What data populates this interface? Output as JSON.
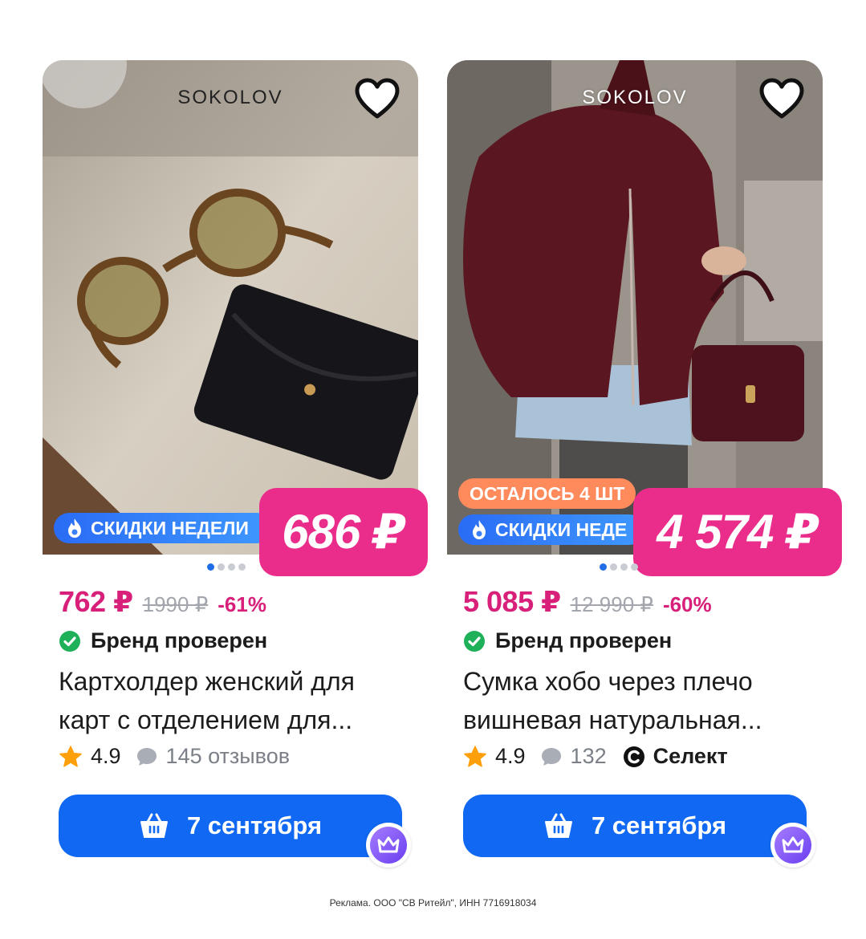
{
  "products": [
    {
      "brand": "SOKOLOV",
      "badges": {
        "sale": "СКИДКИ НЕДЕЛИ"
      },
      "big_price": "686 ₽",
      "price_now": "762 ₽",
      "price_old": "1990 ₽",
      "discount": "-61%",
      "verified": "Бренд проверен",
      "title_line1": "Картхолдер женский для",
      "title_line2": "карт с отделением для...",
      "rating": "4.9",
      "reviews": "145 отзывов",
      "delivery": "7 сентября"
    },
    {
      "brand": "SOKOLOV",
      "badges": {
        "left": "ОСТАЛОСЬ 4 ШТ",
        "sale": "СКИДКИ НЕДЕ"
      },
      "big_price": "4 574 ₽",
      "price_now": "5 085 ₽",
      "price_old": "12 990 ₽",
      "discount": "-60%",
      "verified": "Бренд проверен",
      "title_line1": "Сумка хобо через плечо",
      "title_line2": "вишневая натуральная...",
      "rating": "4.9",
      "reviews": "132",
      "select": "Селект",
      "delivery": "7 сентября"
    }
  ],
  "icons": {
    "favorite": "heart-icon",
    "sale": "fire-icon",
    "verified": "check-circle-icon",
    "rating": "star-icon",
    "reviews": "speech-bubble-icon",
    "select": "select-logo-icon",
    "basket": "basket-icon",
    "crown": "crown-icon"
  },
  "colors": {
    "accent_pink": "#ea2c8b",
    "price_pink": "#d8207a",
    "button_blue": "#1068f3",
    "verified_green": "#1fb15a",
    "star_orange": "#ff9f0a"
  },
  "footer": {
    "ad_text": "Реклама. ООО \"СВ Ритейл\", ИНН 7716918034"
  }
}
